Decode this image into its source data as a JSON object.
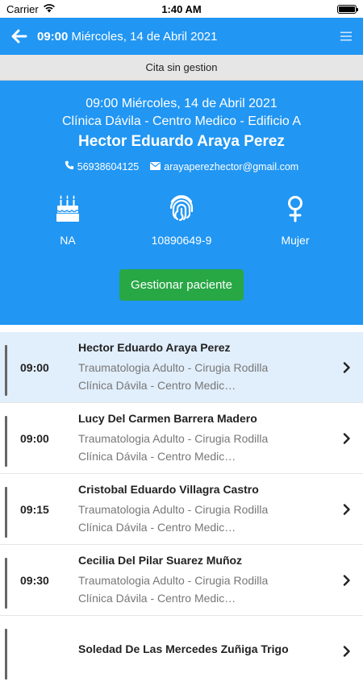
{
  "status": {
    "carrier": "Carrier",
    "time": "1:40 AM",
    "battery_level": 1.0
  },
  "navbar": {
    "time": "09:00",
    "date": "Miércoles, 14 de Abril 2021"
  },
  "subbar": {
    "label": "Cita sin gestion"
  },
  "hero": {
    "datetime": "09:00 Miércoles, 14 de Abril 2021",
    "location": "Clínica Dávila - Centro Medico - Edificio A",
    "patient_name": "Hector Eduardo Araya Perez",
    "phone": "56938604125",
    "email": "arayaperezhector@gmail.com",
    "stats": [
      {
        "icon": "birthday-cake-icon",
        "value": "NA"
      },
      {
        "icon": "fingerprint-icon",
        "value": "10890649-9"
      },
      {
        "icon": "female-icon",
        "value": "Mujer"
      }
    ],
    "button_label": "Gestionar paciente"
  },
  "appointments": [
    {
      "time": "09:00",
      "name": "Hector Eduardo Araya Perez",
      "specialty": "Traumatologia Adulto - Cirugia Rodilla",
      "clinic": "Clínica Dávila - Centro Medic…"
    },
    {
      "time": "09:00",
      "name": "Lucy Del Carmen Barrera Madero",
      "specialty": "Traumatologia Adulto - Cirugia Rodilla",
      "clinic": "Clínica Dávila - Centro Medic…"
    },
    {
      "time": "09:15",
      "name": "Cristobal Eduardo Villagra Castro",
      "specialty": "Traumatologia Adulto - Cirugia Rodilla",
      "clinic": "Clínica Dávila - Centro Medic…"
    },
    {
      "time": "09:30",
      "name": "Cecilia Del Pilar Suarez Muñoz",
      "specialty": "Traumatologia Adulto - Cirugia Rodilla",
      "clinic": "Clínica Dávila - Centro Medic…"
    },
    {
      "time": "",
      "name": "Soledad De Las Mercedes Zuñiga Trigo",
      "specialty": "",
      "clinic": ""
    }
  ],
  "colors": {
    "primary": "#2196f3",
    "success": "#28a745",
    "active_row": "#e1eefb"
  }
}
